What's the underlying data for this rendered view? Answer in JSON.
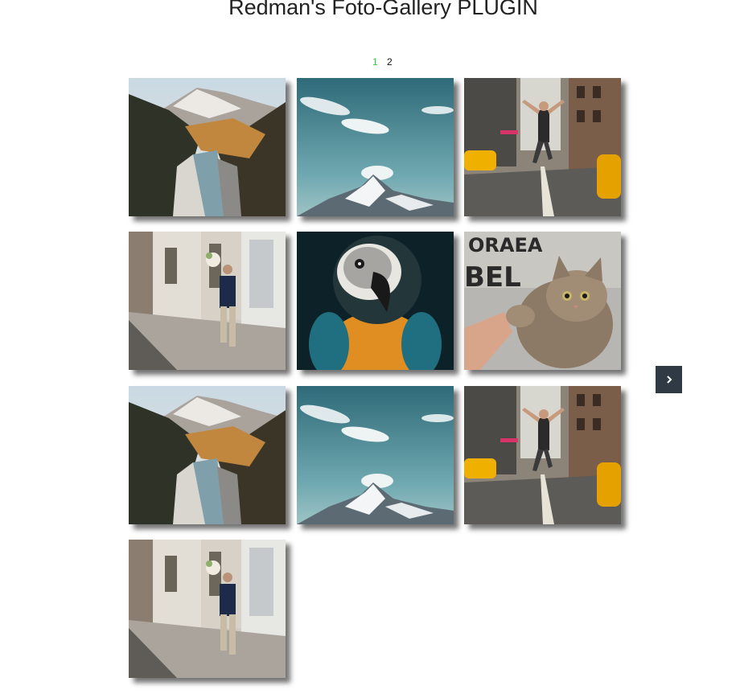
{
  "page": {
    "title": "Redman's Foto-Gallery PLUGIN"
  },
  "pagination": {
    "pages": [
      "1",
      "2"
    ],
    "current": "1"
  },
  "gallery": {
    "photos": [
      {
        "subject": "mountain river valley"
      },
      {
        "subject": "snowy mountain peak with clouds"
      },
      {
        "subject": "dancer jumping in city street"
      },
      {
        "subject": "man walking with flowers"
      },
      {
        "subject": "macaw parrot"
      },
      {
        "subject": "kitten"
      },
      {
        "subject": "mountain river valley"
      },
      {
        "subject": "snowy mountain peak with clouds"
      },
      {
        "subject": "dancer jumping in city street"
      },
      {
        "subject": "man walking with flowers"
      }
    ]
  },
  "controls": {
    "next_icon": "chevron-right-icon",
    "next_label": "›"
  },
  "colors": {
    "active_page": "#2ecc40",
    "next_button_bg": "#2f3a45"
  }
}
